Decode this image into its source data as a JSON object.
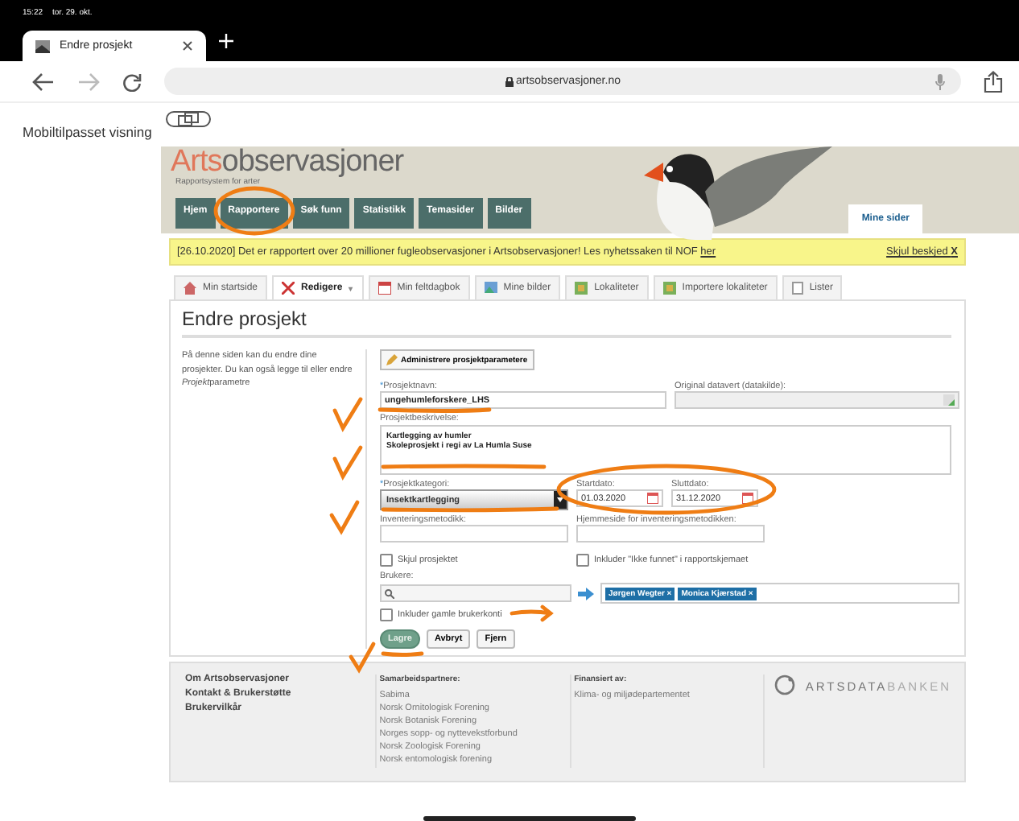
{
  "status_bar": {
    "time": "15:22",
    "date": "tor. 29. okt."
  },
  "browser": {
    "tab": {
      "title": "Endre prosjekt"
    },
    "url": "artsobservasjoner.no",
    "mobile_view": "Mobiltilpasset visning"
  },
  "site": {
    "logo": {
      "first": "Arts",
      "rest": "observasjoner"
    },
    "tagline": "Rapportsystem for arter",
    "nav": [
      {
        "label": "Hjem",
        "selected": false
      },
      {
        "label": "Rapportere",
        "selected": false
      },
      {
        "label": "Søk funn",
        "selected": false
      },
      {
        "label": "Statistikk",
        "selected": false
      },
      {
        "label": "Temasider",
        "selected": false
      },
      {
        "label": "Bilder",
        "selected": false
      }
    ],
    "my_pages": "Mine sider"
  },
  "notice": {
    "text": "[26.10.2020] Det er rapportert over 20 millioner fugleobservasjoner i Artsobservasjoner! Les nyhetssaken til NOF",
    "link": "her",
    "hide": "Skjul beskjed",
    "hide_icon": "X"
  },
  "tabs": [
    {
      "label": "Min startside",
      "selected": false
    },
    {
      "label": "Redigere",
      "selected": true,
      "dropdown": "▾"
    },
    {
      "label": "Min feltdagbok",
      "selected": false
    },
    {
      "label": "Mine bilder",
      "selected": false
    },
    {
      "label": "Lokaliteter",
      "selected": false
    },
    {
      "label": "Importere lokaliteter",
      "selected": false
    },
    {
      "label": "Lister",
      "selected": false
    }
  ],
  "page": {
    "heading": "Endre prosjekt",
    "intro": [
      {
        "text": "På denne siden kan du endre dine prosjekter. Du kan også legge til eller endre ",
        "italic": false
      },
      {
        "text": "Projekt",
        "italic": true
      },
      {
        "text": "parametre",
        "italic": false
      }
    ],
    "admin_button": "Administrere prosjektparametere",
    "fields": {
      "name": {
        "label": "Prosjektnavn:",
        "required_mark": "*",
        "value": "ungehumleforskere_LHS"
      },
      "source": {
        "label": "Original datavert (datakilde):",
        "disabled": true
      },
      "description": {
        "label": "Prosjektbeskrivelse:",
        "lines": [
          "Kartlegging av humler",
          "Skoleprosjekt i regi av La Humla Suse"
        ]
      },
      "category": {
        "label": "Prosjektkategori:",
        "required_mark": "*",
        "value": "Insektkartlegging"
      },
      "start": {
        "label": "Startdato:",
        "value": "01.03.2020"
      },
      "end": {
        "label": "Sluttdato:",
        "value": "31.12.2020"
      },
      "method": {
        "label": "Inventeringsmetodikk:"
      },
      "homepage": {
        "label": "Hjemmeside for inventeringsmetodikken:"
      }
    },
    "checkboxes": [
      {
        "label": "Skjul prosjektet",
        "checked": false
      },
      {
        "label": "Inkluder \"Ikke funnet\" i rapportskjemaet",
        "checked": false
      }
    ],
    "users": {
      "label": "Brukere:",
      "tags": [
        {
          "name": "Jørgen Wegter",
          "remove": "×"
        },
        {
          "name": "Monica Kjærstad",
          "remove": "×"
        }
      ],
      "old_accounts": {
        "label": "Inkluder gamle brukerkonti",
        "checked": false
      }
    },
    "buttons": [
      {
        "label": "Lagre",
        "kind": "primary"
      },
      {
        "label": "Avbryt",
        "kind": "plain"
      },
      {
        "label": "Fjern",
        "kind": "plain"
      }
    ]
  },
  "footer": {
    "links": [
      "Om Artsobservasjoner",
      "Kontakt & Brukerstøtte",
      "Brukervilkår"
    ],
    "partners": {
      "heading": "Samarbeidspartnere:",
      "items": [
        "Sabima",
        "Norsk Ornitologisk Forening",
        "Norsk Botanisk Forening",
        "Norges sopp- og nyttevekstforbund",
        "Norsk Zoologisk Forening",
        "Norsk entomologisk forening"
      ]
    },
    "funding": {
      "heading": "Finansiert av:",
      "items": [
        "Klima- og miljødepartementet"
      ]
    },
    "brand": {
      "first": "ARTSDATA",
      "rest": "BANKEN"
    }
  }
}
